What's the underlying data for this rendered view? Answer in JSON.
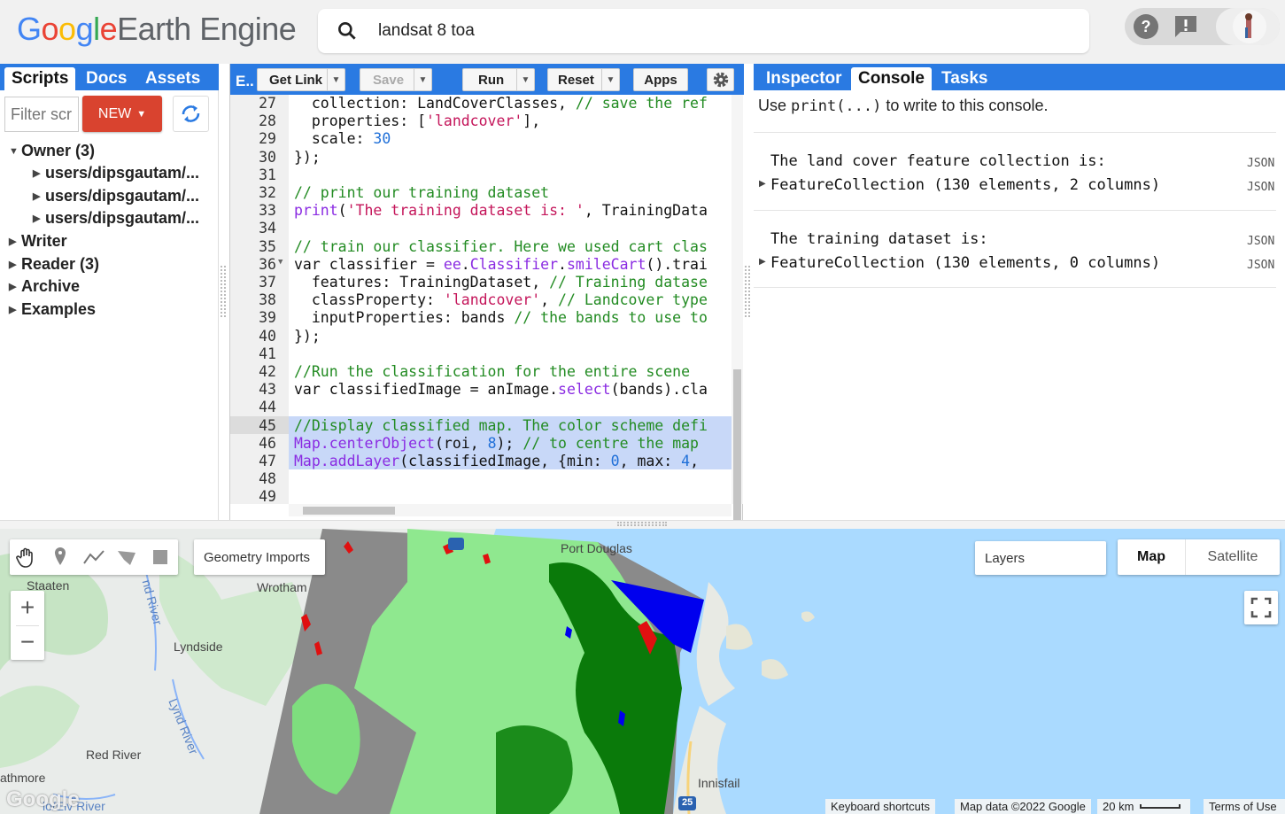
{
  "app": {
    "logo_google": "Google",
    "logo_product": "Earth Engine",
    "search_value": "landsat 8 toa",
    "colors": {
      "accent": "#2a7ae2",
      "new_button": "#d9432f"
    }
  },
  "left_panel": {
    "tabs": [
      "Scripts",
      "Docs",
      "Assets"
    ],
    "filter_placeholder": "Filter scripts",
    "new_label": "NEW",
    "tree": [
      {
        "label": "Owner (3)",
        "expanded": true
      },
      {
        "label": "users/dipsgautam/...",
        "child": true
      },
      {
        "label": "users/dipsgautam/...",
        "child": true
      },
      {
        "label": "users/dipsgautam/...",
        "child": true
      },
      {
        "label": "Writer"
      },
      {
        "label": "Reader (3)"
      },
      {
        "label": "Archive"
      },
      {
        "label": "Examples"
      }
    ]
  },
  "editor": {
    "tab_label": "E..",
    "buttons": {
      "get_link": "Get Link",
      "save": "Save",
      "run": "Run",
      "reset": "Reset",
      "apps": "Apps"
    },
    "line_numbers": [
      "27",
      "28",
      "29",
      "30",
      "31",
      "32",
      "33",
      "34",
      "35",
      "36",
      "37",
      "38",
      "39",
      "40",
      "41",
      "42",
      "43",
      "44",
      "45",
      "46",
      "47",
      "48",
      "49"
    ],
    "code_lines": [
      "  collection: LandCoverClasses, // save the ref",
      "  properties: ['landcover'],",
      "  scale: 30",
      "});",
      "",
      "// print our training dataset",
      "print('The training dataset is: ', TrainingData",
      "",
      "// train our classifier. Here we used cart clas",
      "var classifier = ee.Classifier.smileCart().trai",
      "  features: TrainingDataset, // Training datase",
      "  classProperty: 'landcover', // Landcover type",
      "  inputProperties: bands // the bands to use to",
      "});",
      "",
      "//Run the classification for the entire scene",
      "var classifiedImage = anImage.select(bands).cla",
      "",
      "//Display classified map. The color scheme defi",
      "Map.centerObject(roi, 8); // to centre the map",
      "Map.addLayer(classifiedImage, {min: 0, max: 4,",
      "",
      ""
    ]
  },
  "right_panel": {
    "tabs": [
      "Inspector",
      "Console",
      "Tasks"
    ],
    "hint_prefix": "Use ",
    "hint_code": "print(...)",
    "hint_suffix": " to write to this console.",
    "entries": [
      {
        "title": "The land cover feature collection is:",
        "value": "FeatureCollection (130 elements, 2 columns)",
        "json": "JSON"
      },
      {
        "title": "The training dataset is:",
        "value": "FeatureCollection (130 elements, 0 columns)",
        "json": "JSON"
      }
    ]
  },
  "map": {
    "geometry_imports": "Geometry Imports",
    "layers": "Layers",
    "map_btn": "Map",
    "satellite_btn": "Satellite",
    "places": {
      "staaten": "Staaten",
      "wrotham": "Wrotham",
      "lyndside": "Lyndside",
      "red_river": "Red River",
      "port_douglas": "Port Douglas",
      "innisfail": "Innisfail",
      "athmore": "athmore",
      "lynd_river": "Lynd River",
      "nd_river": "nd River",
      "riv_bottom": "lo/Elv River"
    },
    "highway_shield": "25",
    "footer": {
      "shortcuts": "Keyboard shortcuts",
      "data": "Map data ©2022 Google",
      "scale": "20 km",
      "terms": "Terms of Use"
    },
    "google_mark": "Google"
  }
}
